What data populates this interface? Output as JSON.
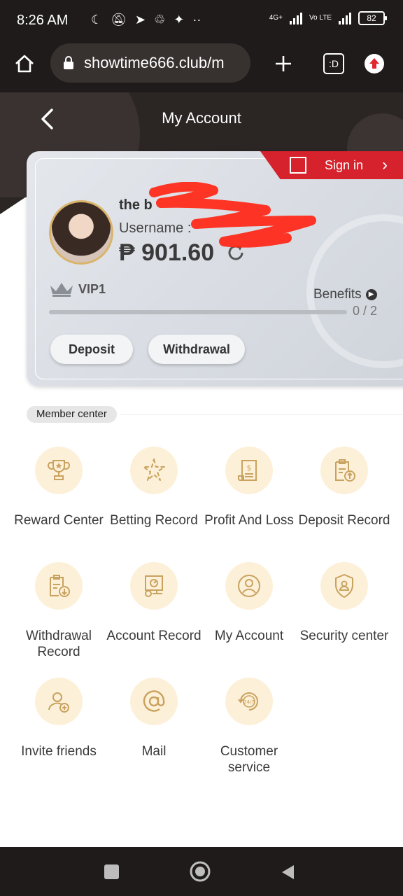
{
  "status_bar": {
    "time": "8:26 AM",
    "network_1": "4G+",
    "network_2": "Vo LTE",
    "battery": "82"
  },
  "browser": {
    "url": "showtime666.club/m",
    "tab_count": ":D"
  },
  "header": {
    "title": "My Account"
  },
  "sign_in": {
    "label": "Sign in"
  },
  "profile": {
    "nickname": "the b",
    "username_label": "Username :",
    "balance": "₱ 901.60"
  },
  "vip": {
    "level": "VIP1",
    "benefits_label": "Benefits",
    "progress_text": "0 / 2",
    "progress_fraction": 0
  },
  "actions": {
    "deposit": "Deposit",
    "withdrawal": "Withdrawal"
  },
  "member_center": {
    "title": "Member center",
    "items": [
      {
        "label": "Reward Center",
        "icon": "trophy-icon"
      },
      {
        "label": "Betting Record",
        "icon": "star-burst-icon"
      },
      {
        "label": "Profit And Loss",
        "icon": "bill-icon"
      },
      {
        "label": "Deposit Record",
        "icon": "clipboard-up-icon"
      },
      {
        "label": "Withdrawal Record",
        "icon": "clipboard-down-icon"
      },
      {
        "label": "Account Record",
        "icon": "chart-record-icon"
      },
      {
        "label": "My Account",
        "icon": "user-circle-icon"
      },
      {
        "label": "Security center",
        "icon": "shield-user-icon"
      },
      {
        "label": "Invite friends",
        "icon": "add-user-icon"
      },
      {
        "label": "Mail",
        "icon": "at-sign-icon"
      },
      {
        "label": "Customer service",
        "icon": "support-24-7-icon"
      }
    ]
  },
  "colors": {
    "dark_header": "#2b2524",
    "signin_red": "#d5222c",
    "icon_bg": "#fdf0d8",
    "icon_stroke": "#c9a25f",
    "avatar_ring": "#d9b46a"
  }
}
